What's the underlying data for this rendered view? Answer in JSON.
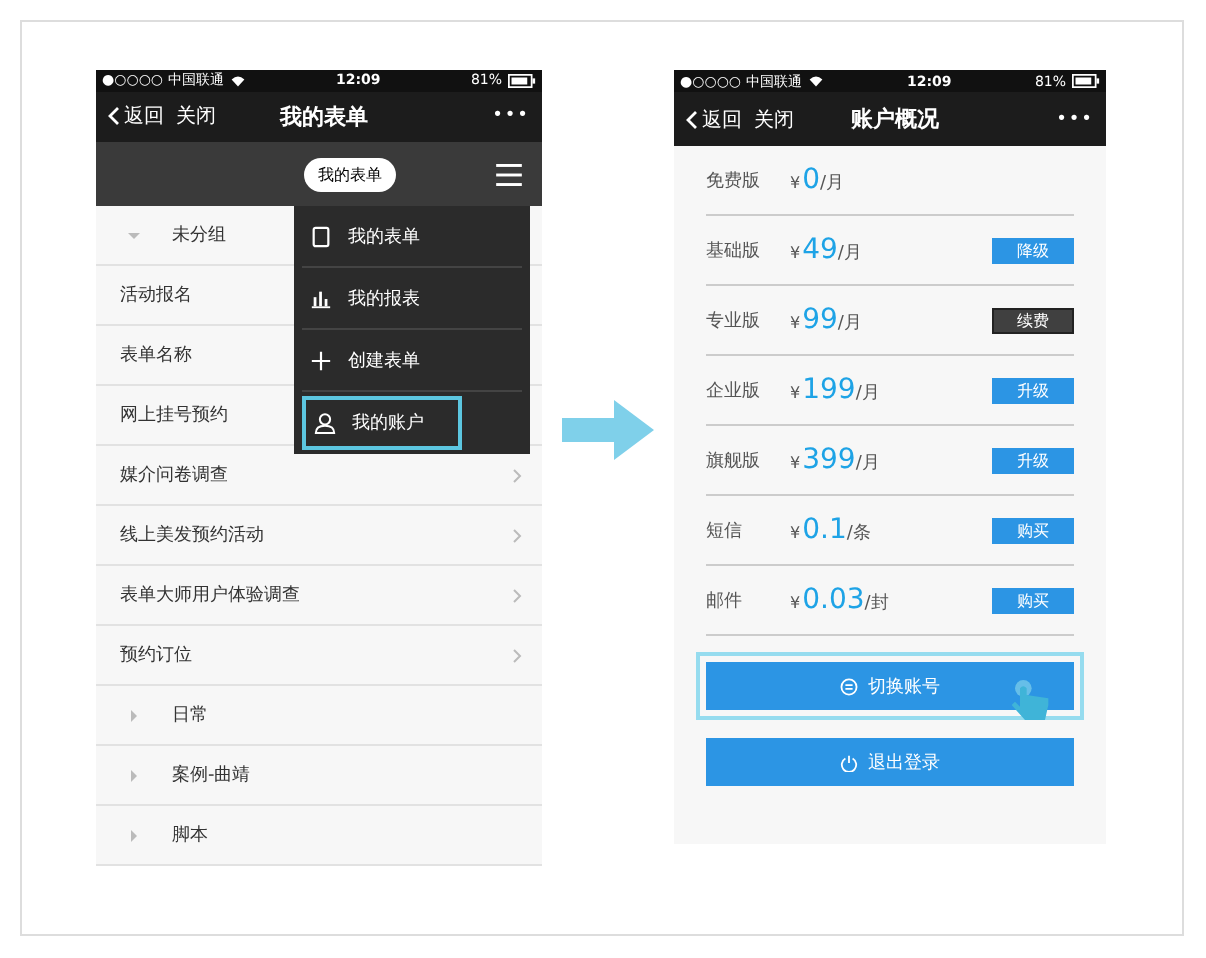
{
  "left_phone": {
    "status_bar": {
      "carrier": "●○○○○ 中国联通",
      "time": "12:09",
      "battery": "81%"
    },
    "nav": {
      "back": "返回",
      "close": "关闭",
      "title": "我的表单",
      "more": "•••"
    },
    "toolbar": {
      "pill": "我的表单"
    },
    "list": [
      {
        "kind": "group",
        "label": "未分组",
        "expanded": true
      },
      {
        "kind": "form",
        "label": "活动报名"
      },
      {
        "kind": "form",
        "label": "表单名称"
      },
      {
        "kind": "form",
        "label": "网上挂号预约"
      },
      {
        "kind": "form",
        "label": "媒介问卷调查",
        "chevron": true
      },
      {
        "kind": "form",
        "label": "线上美发预约活动",
        "chevron": true
      },
      {
        "kind": "form",
        "label": "表单大师用户体验调查",
        "chevron": true
      },
      {
        "kind": "form",
        "label": "预约订位",
        "chevron": true
      },
      {
        "kind": "group",
        "label": "日常",
        "expanded": false
      },
      {
        "kind": "group",
        "label": "案例-曲靖",
        "expanded": false
      },
      {
        "kind": "group",
        "label": "脚本",
        "expanded": false
      }
    ],
    "menu": [
      {
        "kind": "form",
        "label": "我的表单",
        "selected": false
      },
      {
        "kind": "report",
        "label": "我的报表",
        "selected": false
      },
      {
        "kind": "create",
        "label": "创建表单",
        "selected": false
      },
      {
        "kind": "account",
        "label": "我的账户",
        "selected": true
      }
    ]
  },
  "right_phone": {
    "status_bar": {
      "carrier": "●○○○○ 中国联通",
      "time": "12:09",
      "battery": "81%"
    },
    "nav": {
      "back": "返回",
      "close": "关闭",
      "title": "账户概况",
      "more": "•••"
    },
    "plans": [
      {
        "name": "免费版",
        "currency": "¥",
        "price": "0",
        "unit": "/月"
      },
      {
        "name": "基础版",
        "currency": "¥",
        "price": "49",
        "unit": "/月",
        "button": {
          "label": "降级",
          "kind": "primary"
        }
      },
      {
        "name": "专业版",
        "currency": "¥",
        "price": "99",
        "unit": "/月",
        "button": {
          "label": "续费",
          "kind": "dark"
        }
      },
      {
        "name": "企业版",
        "currency": "¥",
        "price": "199",
        "unit": "/月",
        "button": {
          "label": "升级",
          "kind": "primary"
        }
      },
      {
        "name": "旗舰版",
        "currency": "¥",
        "price": "399",
        "unit": "/月",
        "button": {
          "label": "升级",
          "kind": "primary"
        }
      },
      {
        "name": "短信",
        "currency": "¥",
        "price": "0.1",
        "unit": "/条",
        "button": {
          "label": "购买",
          "kind": "primary"
        }
      },
      {
        "name": "邮件",
        "currency": "¥",
        "price": "0.03",
        "unit": "/封",
        "button": {
          "label": "购买",
          "kind": "primary"
        }
      }
    ],
    "actions": [
      {
        "kind": "switch",
        "label": "切换账号",
        "highlighted": true
      },
      {
        "kind": "logout",
        "label": "退出登录",
        "highlighted": false
      }
    ]
  }
}
